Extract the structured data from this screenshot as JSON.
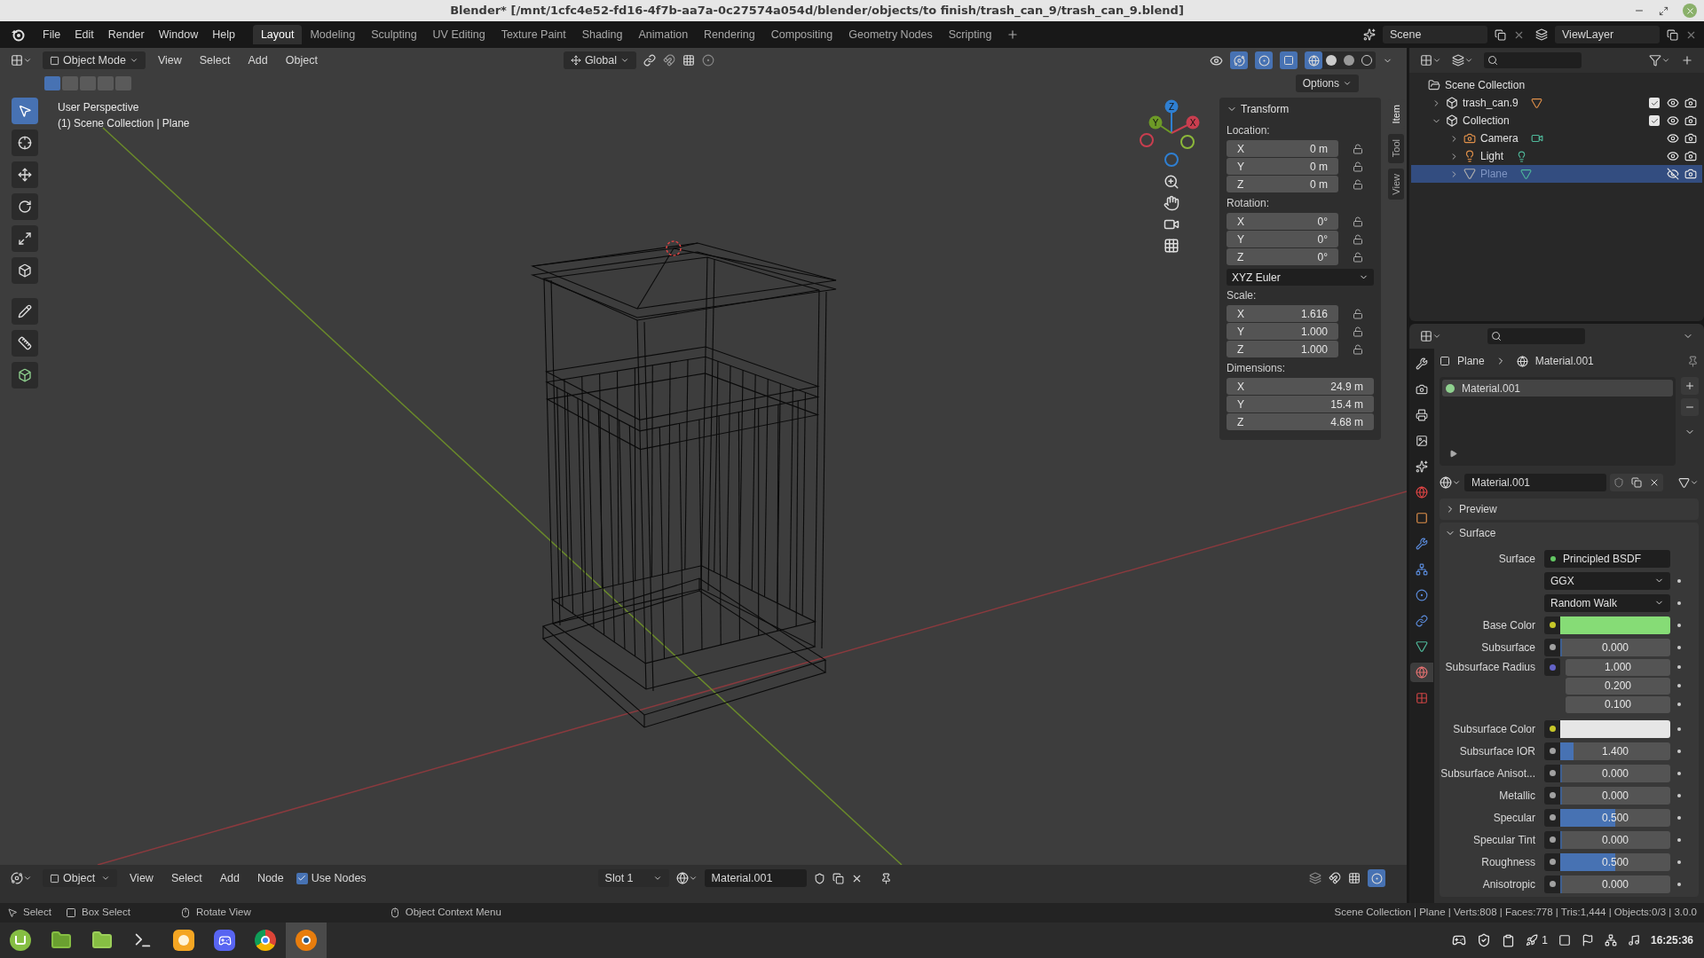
{
  "window": {
    "title": "Blender* [/mnt/1cfc4e52-fd16-4f7b-aa7a-0c27574a054d/blender/objects/to finish/trash_can_9/trash_can_9.blend]"
  },
  "menu": [
    "File",
    "Edit",
    "Render",
    "Window",
    "Help"
  ],
  "workspaces": [
    {
      "label": "Layout",
      "selected": true
    },
    {
      "label": "Modeling",
      "selected": false
    },
    {
      "label": "Sculpting",
      "selected": false
    },
    {
      "label": "UV Editing",
      "selected": false
    },
    {
      "label": "Texture Paint",
      "selected": false
    },
    {
      "label": "Shading",
      "selected": false
    },
    {
      "label": "Animation",
      "selected": false
    },
    {
      "label": "Rendering",
      "selected": false
    },
    {
      "label": "Compositing",
      "selected": false
    },
    {
      "label": "Geometry Nodes",
      "selected": false
    },
    {
      "label": "Scripting",
      "selected": false
    }
  ],
  "scene": "Scene",
  "view_layer": "ViewLayer",
  "viewport_header": {
    "mode": "Object Mode",
    "menus": [
      "View",
      "Select",
      "Add",
      "Object"
    ],
    "orientation": "Global",
    "options": "Options"
  },
  "viewport_overlay": {
    "perspective": "User Perspective",
    "context": "(1) Scene Collection | Plane"
  },
  "gizmo_axes": [
    {
      "label": "Z",
      "color": "#2f7fd1"
    },
    {
      "label": "Y",
      "color": "#6d9a27"
    },
    {
      "label": "X",
      "color": "#c93e4f"
    }
  ],
  "sidebar_tabs": [
    {
      "label": "Item",
      "selected": true
    },
    {
      "label": "Tool",
      "selected": false
    },
    {
      "label": "View",
      "selected": false
    }
  ],
  "transform": {
    "title": "Transform",
    "sections": [
      {
        "kind": "group",
        "label": "Location:",
        "lockable": true,
        "fields": [
          {
            "axis": "X",
            "value": "0 m"
          },
          {
            "axis": "Y",
            "value": "0 m"
          },
          {
            "axis": "Z",
            "value": "0 m"
          }
        ]
      },
      {
        "kind": "group",
        "label": "Rotation:",
        "lockable": true,
        "fields": [
          {
            "axis": "X",
            "value": "0°"
          },
          {
            "axis": "Y",
            "value": "0°"
          },
          {
            "axis": "Z",
            "value": "0°"
          }
        ]
      },
      {
        "kind": "dropdown",
        "value": "XYZ Euler"
      },
      {
        "kind": "group",
        "label": "Scale:",
        "lockable": true,
        "fields": [
          {
            "axis": "X",
            "value": "1.616"
          },
          {
            "axis": "Y",
            "value": "1.000"
          },
          {
            "axis": "Z",
            "value": "1.000"
          }
        ]
      },
      {
        "kind": "group",
        "label": "Dimensions:",
        "lockable": false,
        "fields": [
          {
            "axis": "X",
            "value": "24.9 m"
          },
          {
            "axis": "Y",
            "value": "15.4 m"
          },
          {
            "axis": "Z",
            "value": "4.68 m"
          }
        ]
      }
    ]
  },
  "outliner": {
    "items": [
      {
        "label": "Scene Collection",
        "kind": "scene",
        "children": [
          {
            "label": "trash_can.9",
            "kind": "collection",
            "expanded": false,
            "checked": true,
            "visible": true,
            "selected": false
          },
          {
            "label": "Collection",
            "kind": "collection",
            "expanded": true,
            "checked": true,
            "visible": true,
            "selected": false,
            "children": [
              {
                "label": "Camera",
                "kind": "camera",
                "expanded": false,
                "visible": true,
                "selected": false
              },
              {
                "label": "Light",
                "kind": "light",
                "expanded": false,
                "visible": true,
                "selected": false
              },
              {
                "label": "Plane",
                "kind": "mesh",
                "expanded": false,
                "visible": false,
                "selected": true
              }
            ]
          }
        ]
      }
    ]
  },
  "properties": {
    "breadcrumb": [
      "Plane",
      "Material.001"
    ],
    "tabs": [
      {
        "kind": "tool",
        "selected": false
      },
      {
        "kind": "render",
        "selected": false
      },
      {
        "kind": "output",
        "selected": false
      },
      {
        "kind": "view_layer",
        "selected": false
      },
      {
        "kind": "scene",
        "selected": false
      },
      {
        "kind": "world",
        "selected": false
      },
      {
        "kind": "object",
        "selected": false
      },
      {
        "kind": "modifiers",
        "selected": false
      },
      {
        "kind": "particles",
        "selected": false
      },
      {
        "kind": "physics",
        "selected": false
      },
      {
        "kind": "constraints",
        "selected": false
      },
      {
        "kind": "data",
        "selected": false
      },
      {
        "kind": "material",
        "selected": true
      },
      {
        "kind": "texture",
        "selected": false
      }
    ],
    "slots": [
      {
        "label": "Material.001",
        "selected": true
      }
    ],
    "material_name": "Material.001",
    "panels": [
      {
        "label": "Preview",
        "expanded": false
      },
      {
        "label": "Surface",
        "expanded": true
      }
    ],
    "rows": [
      {
        "kind": "link",
        "label": "Surface",
        "value": "Principled BSDF"
      },
      {
        "kind": "dropdown",
        "value": "GGX"
      },
      {
        "kind": "dropdown",
        "value": "Random Walk"
      },
      {
        "kind": "color",
        "label": "Base Color",
        "color": "#86dc76"
      },
      {
        "kind": "slider",
        "label": "Subsurface",
        "value": "0.000",
        "level": 0
      },
      {
        "kind": "vector",
        "label": "Subsurface Radius",
        "values": [
          "1.000",
          "0.200",
          "0.100"
        ]
      },
      {
        "kind": "color",
        "label": "Subsurface Color",
        "color": "#e6e6e6"
      },
      {
        "kind": "slider",
        "label": "Subsurface IOR",
        "value": "1.400",
        "level": 0.12
      },
      {
        "kind": "slider",
        "label": "Subsurface Anisot...",
        "value": "0.000",
        "level": 0
      },
      {
        "kind": "slider",
        "label": "Metallic",
        "value": "0.000",
        "level": 0
      },
      {
        "kind": "slider",
        "label": "Specular",
        "value": "0.500",
        "level": 0.5
      },
      {
        "kind": "slider",
        "label": "Specular Tint",
        "value": "0.000",
        "level": 0
      },
      {
        "kind": "slider",
        "label": "Roughness",
        "value": "0.500",
        "level": 0.5
      },
      {
        "kind": "slider",
        "label": "Anisotropic",
        "value": "0.000",
        "level": 0
      }
    ]
  },
  "node_header": {
    "mode": "Object",
    "menus": [
      "View",
      "Select",
      "Add",
      "Node"
    ],
    "use_nodes": {
      "label": "Use Nodes",
      "checked": true
    },
    "slot": "Slot 1",
    "material": "Material.001"
  },
  "status_bar": {
    "hints": [
      "Select",
      "Box Select",
      "Rotate View",
      "Object Context Menu"
    ],
    "stats": "Scene Collection | Plane | Verts:808 | Faces:778 | Tris:1,444 | Objects:0/3 | 3.0.0"
  },
  "taskbar": {
    "apps": [
      {
        "kind": "menu",
        "selected": false
      },
      {
        "kind": "files",
        "selected": false
      },
      {
        "kind": "folder",
        "selected": false
      },
      {
        "kind": "terminal",
        "selected": false
      },
      {
        "kind": "firefox",
        "selected": false
      },
      {
        "kind": "discord",
        "selected": false
      },
      {
        "kind": "chrome",
        "selected": false
      },
      {
        "kind": "blender",
        "selected": true
      }
    ],
    "tray_count": "1",
    "clock": "16:25:36"
  }
}
